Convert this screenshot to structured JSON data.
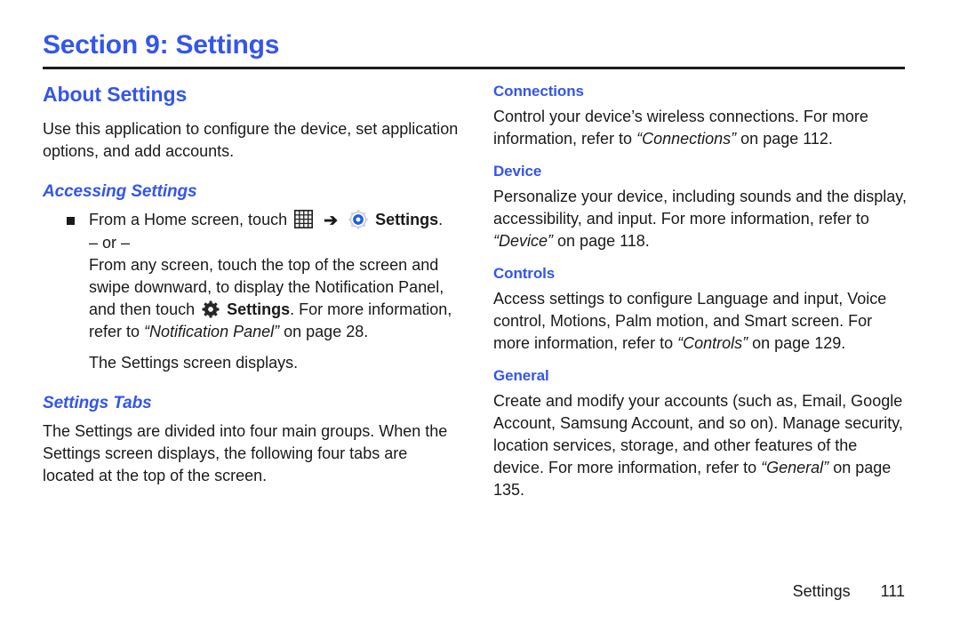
{
  "document": {
    "section_title": "Section 9: Settings",
    "page_footer": {
      "label": "Settings",
      "page_number": "111"
    },
    "accent_color": "#3355ee",
    "text_color": "#1a1a1a"
  },
  "left_column": {
    "about": {
      "heading": "About Settings",
      "intro": "Use this application to configure the device, set application options, and add accounts."
    },
    "accessing": {
      "heading": "Accessing Settings",
      "bullet": {
        "text_before_grid": "From a Home screen, touch",
        "grid_icon": "apps-grid-icon",
        "arrow": "➔",
        "gear_icon": "settings-gear-blue-icon",
        "settings_label": "Settings",
        "period": "."
      },
      "or_separator": "– or –",
      "alt_text_part1": "From any screen, touch the top of the screen and swipe downward, to display the Notification Panel, and then touch",
      "alt_gear_icon": "settings-gear-dark-icon",
      "alt_settings_label": "Settings",
      "alt_text_part2": ". For more information, refer to",
      "alt_reference": "“Notification Panel”",
      "alt_text_part3": "on page 28.",
      "result_text": "The Settings screen displays."
    },
    "settings_tabs": {
      "heading": "Settings Tabs",
      "body": "The Settings are divided into four main groups. When the Settings screen displays, the following four tabs are located at the top of the screen."
    }
  },
  "right_column": {
    "tabs": [
      {
        "name": "Connections",
        "text_before": "Control your device’s wireless connections. For more information, refer to",
        "reference": "“Connections”",
        "text_after": "on page 112."
      },
      {
        "name": "Device",
        "text_before": "Personalize your device, including sounds and the display, accessibility, and input. For more information, refer to",
        "reference": "“Device”",
        "text_after": "on page 118."
      },
      {
        "name": "Controls",
        "text_before": "Access settings to configure Language and input, Voice control, Motions, Palm motion, and Smart screen. For more information, refer to",
        "reference": "“Controls”",
        "text_after": "on page 129."
      },
      {
        "name": "General",
        "text_before": "Create and modify your accounts (such as, Email, Google Account, Samsung Account, and so on). Manage security, location services, storage, and other features of the device. For more information, refer to",
        "reference": "“General”",
        "text_after": "on page 135."
      }
    ]
  }
}
